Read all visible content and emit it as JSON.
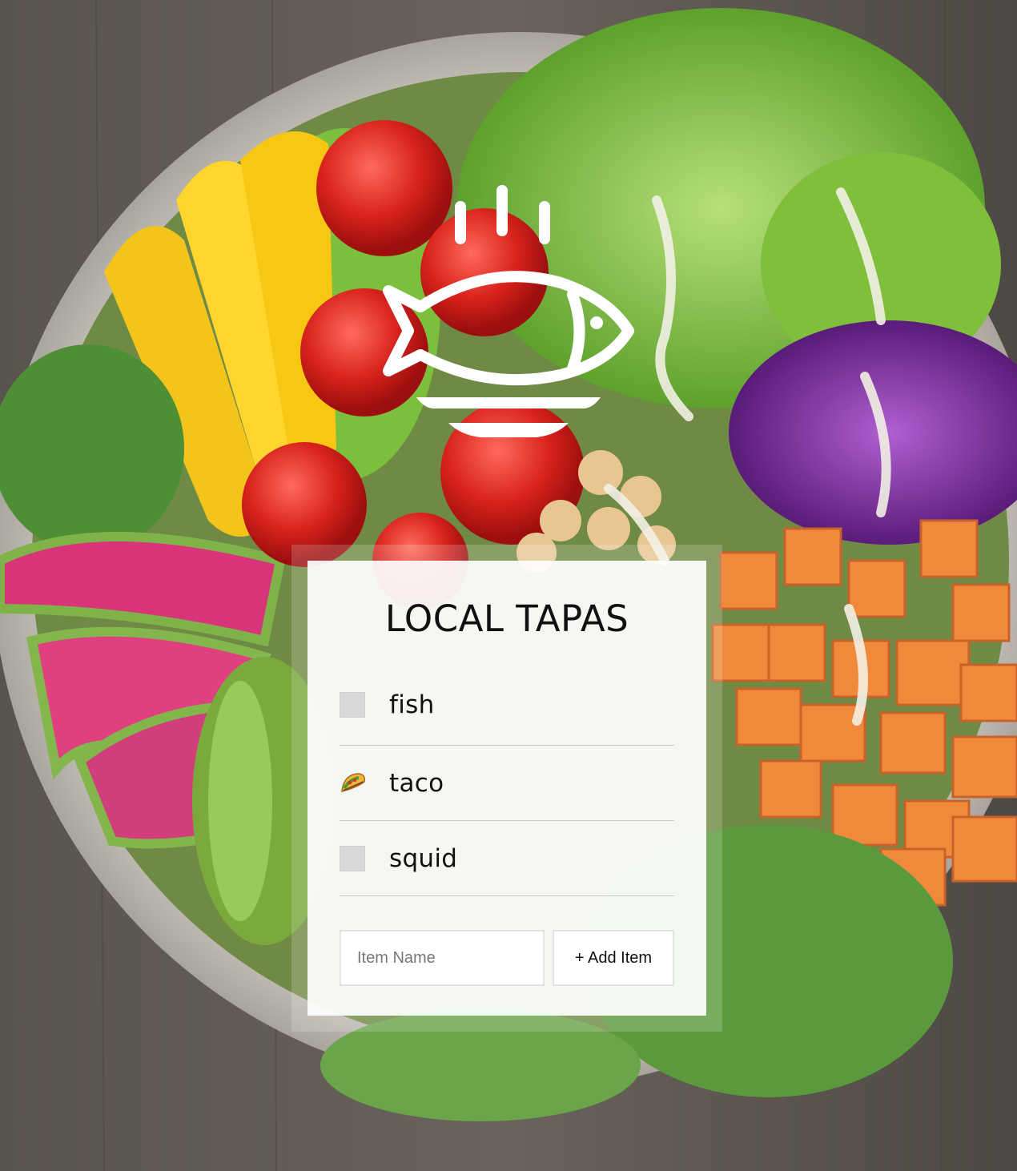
{
  "app": {
    "title": "LOCAL TAPAS"
  },
  "logo": {
    "icon": "fish-on-plate-icon",
    "color": "#ffffff"
  },
  "items": [
    {
      "label": "fish",
      "checked": false,
      "icon": "checkbox-empty-icon"
    },
    {
      "label": "taco",
      "checked": true,
      "icon": "taco-icon"
    },
    {
      "label": "squid",
      "checked": false,
      "icon": "checkbox-empty-icon"
    }
  ],
  "add_form": {
    "input_placeholder": "Item Name",
    "input_value": "",
    "button_label": "+ Add Item"
  },
  "colors": {
    "card_background": "#ffffff",
    "checkbox_unchecked": "#d9d9d9",
    "divider": "#c9c9c9",
    "text": "#111111"
  }
}
